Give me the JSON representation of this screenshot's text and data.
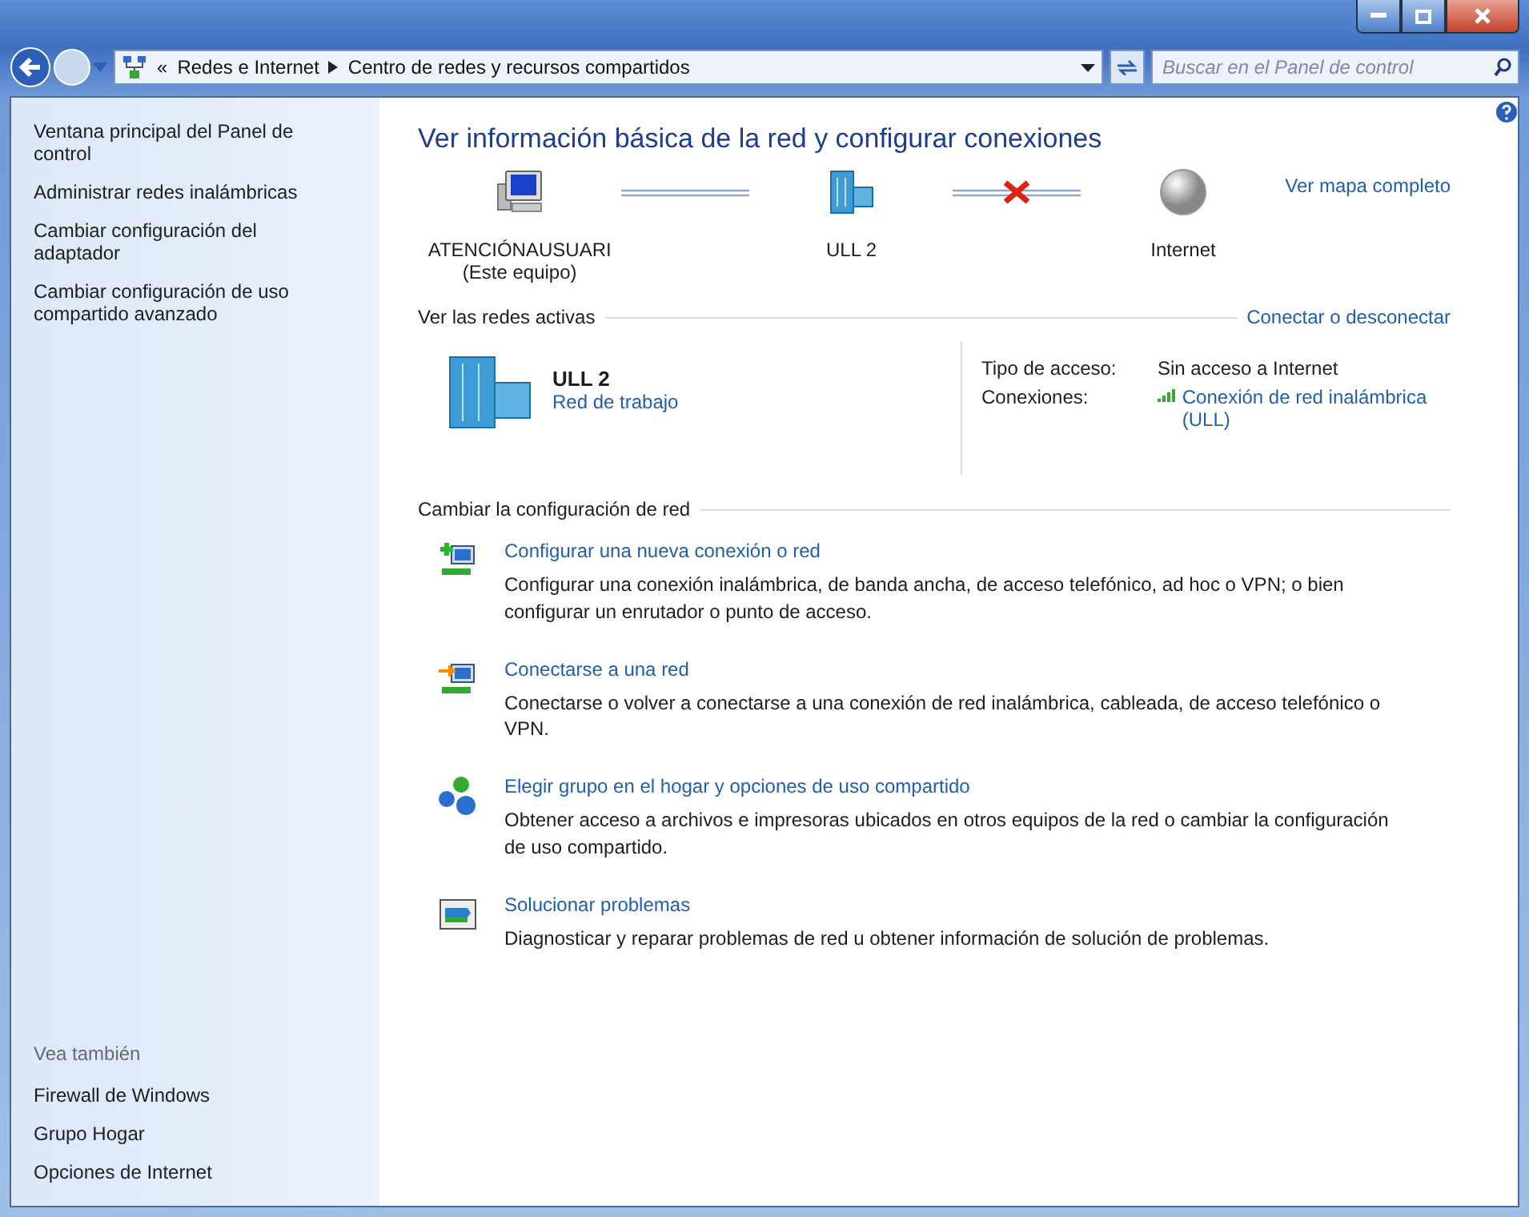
{
  "address_bar": {
    "overflow": "«",
    "path": [
      "Redes e Internet",
      "Centro de redes y recursos compartidos"
    ]
  },
  "search": {
    "placeholder": "Buscar en el Panel de control"
  },
  "sidebar": {
    "items": [
      "Ventana principal del Panel de control",
      "Administrar redes inalámbricas",
      "Cambiar configuración del adaptador",
      "Cambiar configuración de uso compartido avanzado"
    ],
    "see_also": {
      "title": "Vea también",
      "items": [
        "Firewall de Windows",
        "Grupo Hogar",
        "Opciones de Internet"
      ]
    }
  },
  "main": {
    "title": "Ver información básica de la red y configurar conexiones",
    "map": {
      "nodes": [
        {
          "kind": "computer",
          "label": "ATENCIÓNAUSUARI",
          "sublabel": "(Este equipo)"
        },
        {
          "kind": "network",
          "label": "ULL  2"
        },
        {
          "kind": "internet",
          "label": "Internet"
        }
      ],
      "links": [
        {
          "broken": false
        },
        {
          "broken": true
        }
      ],
      "full_map_link": "Ver mapa completo"
    },
    "active_networks": {
      "title": "Ver las redes activas",
      "action": "Conectar o desconectar",
      "network": {
        "name": "ULL  2",
        "type": "Red de trabajo"
      },
      "details": [
        {
          "kind": "text",
          "label": "Tipo de acceso:",
          "value": "Sin acceso a Internet"
        },
        {
          "kind": "link",
          "label": "Conexiones:",
          "value": "Conexión de red inalámbrica (ULL)"
        }
      ]
    },
    "change_settings": {
      "title": "Cambiar la configuración de red",
      "tasks": [
        {
          "kind": "new",
          "title": "Configurar una nueva conexión o red",
          "description": "Configurar una conexión inalámbrica, de banda ancha, de acceso telefónico, ad hoc o VPN; o bien configurar un enrutador o punto de acceso."
        },
        {
          "kind": "connect",
          "title": "Conectarse a una red",
          "description": "Conectarse o volver a conectarse a una conexión de red inalámbrica, cableada, de acceso telefónico o VPN."
        },
        {
          "kind": "homegroup",
          "title": "Elegir grupo en el hogar y opciones de uso compartido",
          "description": "Obtener acceso a archivos e impresoras ubicados en otros equipos de la red o cambiar la configuración de uso compartido."
        },
        {
          "kind": "troubleshoot",
          "title": "Solucionar problemas",
          "description": "Diagnosticar y reparar problemas de red u obtener información de solución de problemas."
        }
      ]
    }
  }
}
